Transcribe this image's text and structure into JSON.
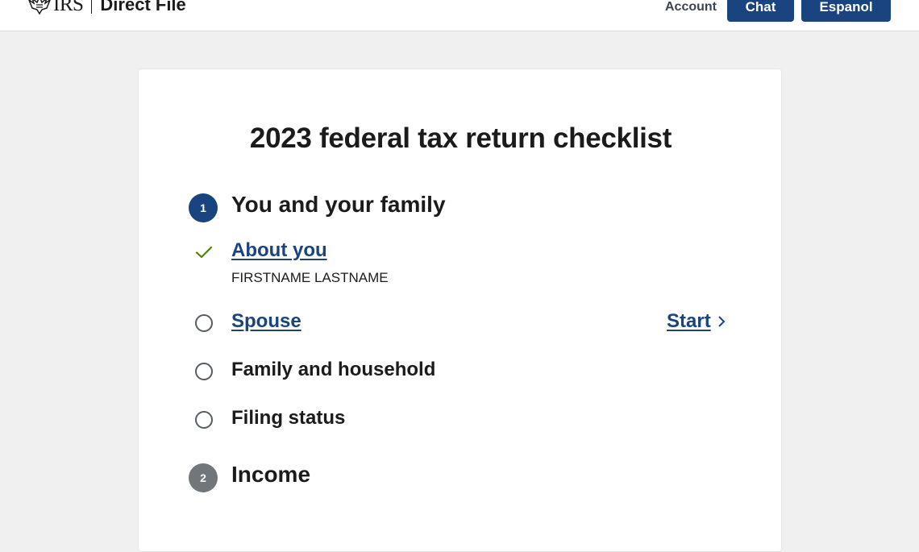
{
  "header": {
    "logo_agency": "IRS",
    "logo_product": "Direct File",
    "account_label": "Account",
    "chat_label": "Chat",
    "espanol_label": "Espanol",
    "brand_color": "#1a4480"
  },
  "checklist": {
    "title": "2023 federal tax return checklist",
    "sections": [
      {
        "number": "1",
        "title": "You and your family",
        "items": [
          {
            "label": "About you",
            "status": "complete",
            "icon": "check-icon",
            "detail": "FIRSTNAME LASTNAME"
          },
          {
            "label": "Spouse",
            "status": "not-started",
            "icon": "empty-circle-icon",
            "action": "Start"
          },
          {
            "label": "Family and household",
            "status": "not-started",
            "icon": "empty-circle-icon"
          },
          {
            "label": "Filing status",
            "status": "not-started",
            "icon": "empty-circle-icon"
          }
        ]
      },
      {
        "number": "2",
        "title": "Income"
      }
    ]
  }
}
